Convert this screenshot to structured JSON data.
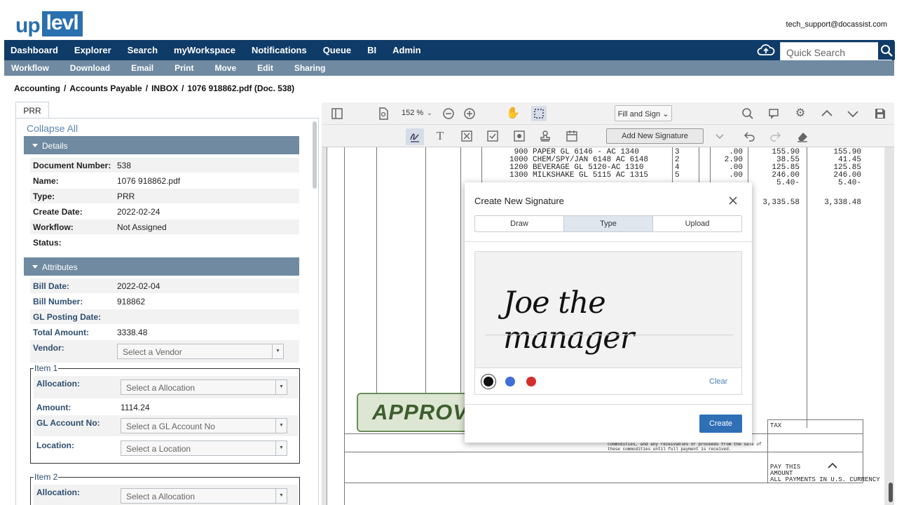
{
  "app": {
    "logo_left": "up",
    "logo_right": "levl",
    "user_email": "tech_support@docassist.com"
  },
  "main_nav": [
    "Dashboard",
    "Explorer",
    "Search",
    "myWorkspace",
    "Notifications",
    "Queue",
    "BI",
    "Admin"
  ],
  "quick_search_placeholder": "Quick Search",
  "sub_nav": [
    "Workflow",
    "Download",
    "Email",
    "Print",
    "Move",
    "Edit",
    "Sharing"
  ],
  "breadcrumb": [
    "Accounting",
    "Accounts Payable",
    "INBOX",
    "1076 918862.pdf (Doc. 538)"
  ],
  "panel": {
    "tab": "PRR",
    "collapse_all": "Collapse All",
    "details_header": "Details",
    "details": [
      {
        "label": "Document Number:",
        "value": "538"
      },
      {
        "label": "Name:",
        "value": "1076 918862.pdf"
      },
      {
        "label": "Type:",
        "value": "PRR"
      },
      {
        "label": "Create Date:",
        "value": "2022-02-24"
      },
      {
        "label": "Workflow:",
        "value": "Not Assigned"
      },
      {
        "label": "Status:",
        "value": ""
      }
    ],
    "attributes_header": "Attributes",
    "attributes": [
      {
        "label": "Bill Date:",
        "value": "2022-02-04"
      },
      {
        "label": "Bill Number:",
        "value": "918862"
      },
      {
        "label": "GL Posting Date:",
        "value": ""
      },
      {
        "label": "Total Amount:",
        "value": "3338.48"
      }
    ],
    "vendor_label": "Vendor:",
    "vendor_placeholder": "Select a Vendor",
    "item1": {
      "legend": "Item 1",
      "allocation_label": "Allocation:",
      "allocation_placeholder": "Select a Allocation",
      "amount_label": "Amount:",
      "amount_value": "1114.24",
      "gl_label": "GL Account No:",
      "gl_placeholder": "Select a GL Account No",
      "location_label": "Location:",
      "location_placeholder": "Select a Location"
    },
    "item2": {
      "legend": "Item 2",
      "allocation_label": "Allocation:",
      "allocation_placeholder": "Select a Allocation"
    }
  },
  "viewer": {
    "zoom": "152 %",
    "mode": "Fill and Sign",
    "add_signature": "Add New Signature",
    "doc_lines": [
      " 900 PAPER GL 6146 - AC 1340",
      "1000 CHEM/SPY/JAN 6148 AC 6148",
      "1200 BEVERAGE GL 5120-AC 1310",
      "1300 MILKSHAKE GL 5115 AC 1315"
    ],
    "doc_qty": [
      "3",
      "2",
      "4",
      "5"
    ],
    "doc_col_a": [
      ".00",
      "2.90",
      ".00",
      ".00"
    ],
    "doc_col_b": [
      "155.90",
      "38.55",
      "125.85",
      "246.00",
      "5.40-",
      "3,335.58"
    ],
    "doc_col_c": [
      "155.90",
      "41.45",
      "125.85",
      "246.00",
      "5.40-",
      "3,338.48"
    ],
    "stamp": "APPROV",
    "tax": "TAX",
    "pay_this": "PAY THIS\nAMOUNT\nALL PAYMENTS IN U.S. CURRENCY",
    "fine_print": "commodities, and any receivables or proceeds from the sale of\nthese commodities until full payment is received."
  },
  "modal": {
    "title": "Create New Signature",
    "tabs": [
      "Draw",
      "Type",
      "Upload"
    ],
    "active_tab": "Type",
    "signature_text": "Joe the manager",
    "colors": [
      "#111111",
      "#3f6fd6",
      "#d32f2f"
    ],
    "selected_color": "#111111",
    "clear_label": "Clear",
    "create_label": "Create"
  }
}
